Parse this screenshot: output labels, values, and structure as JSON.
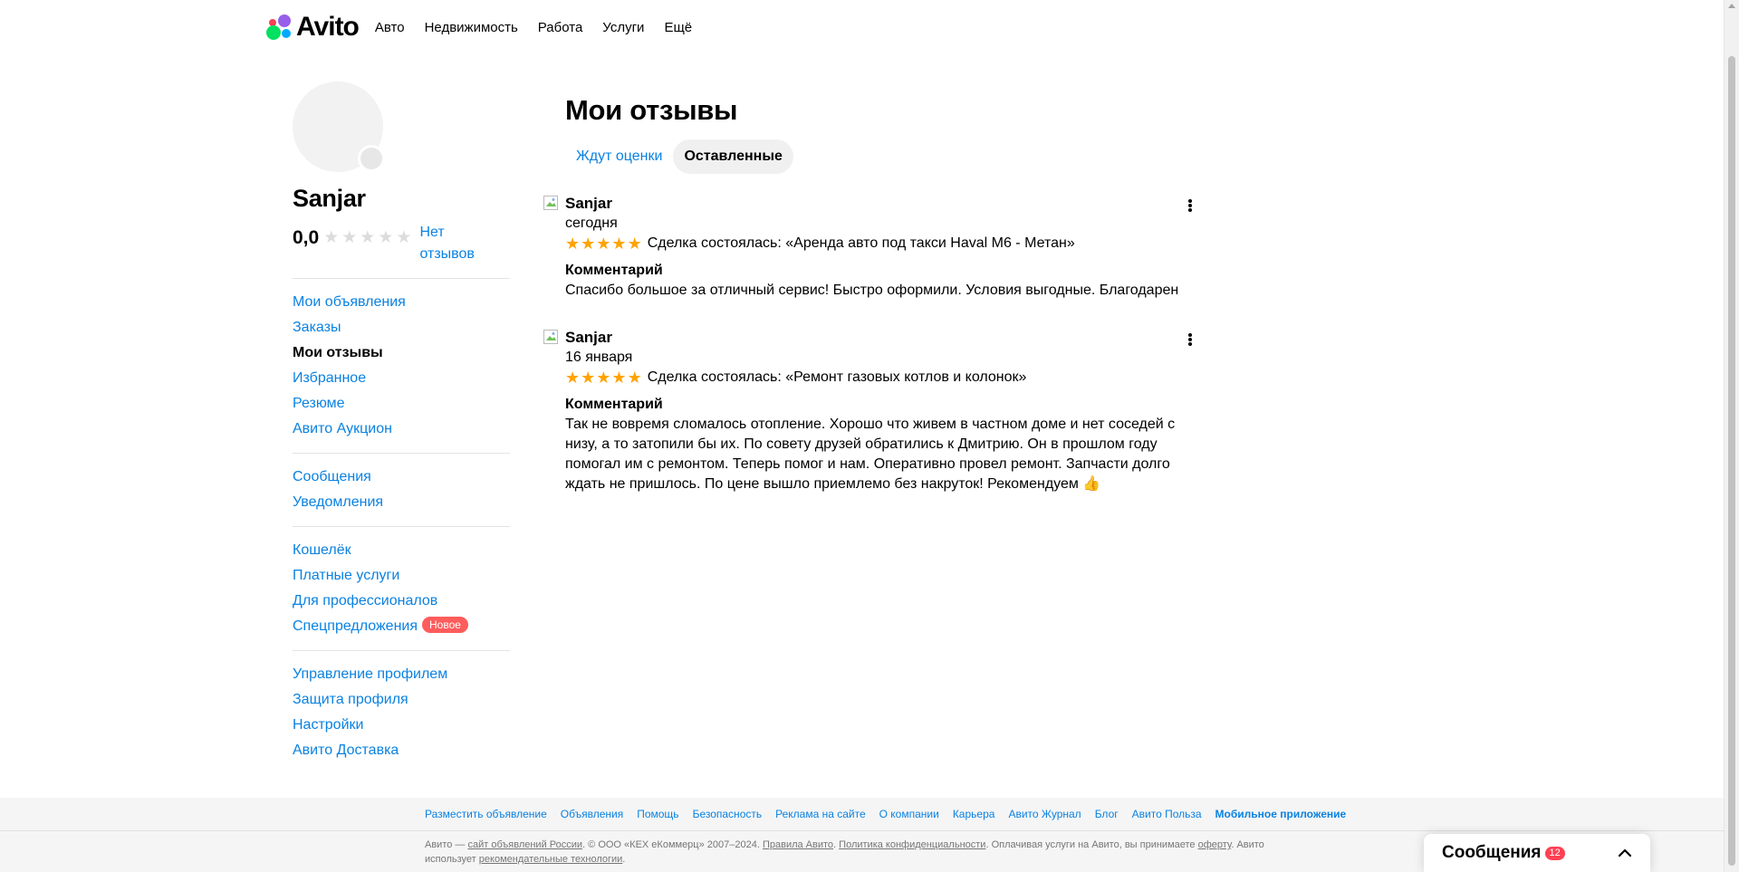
{
  "header": {
    "logo_text": "Avito",
    "nav": [
      "Авто",
      "Недвижимость",
      "Работа",
      "Услуги",
      "Ещё"
    ]
  },
  "profile": {
    "name": "Sanjar",
    "rating": "0,0",
    "rating_stars": 0,
    "no_reviews_line1": "Нет",
    "no_reviews_line2": "отзывов"
  },
  "sidebar": {
    "group1": [
      "Мои объявления",
      "Заказы",
      "Мои отзывы",
      "Избранное",
      "Резюме",
      "Авито Аукцион"
    ],
    "active_item": "Мои отзывы",
    "group2": [
      "Сообщения",
      "Уведомления"
    ],
    "group3": [
      "Кошелёк",
      "Платные услуги",
      "Для профессионалов",
      "Спецпредложения"
    ],
    "new_badge": "Новое",
    "group4": [
      "Управление профилем",
      "Защита профиля",
      "Настройки",
      "Авито Доставка"
    ]
  },
  "main": {
    "title": "Мои отзывы",
    "tabs": [
      {
        "label": "Ждут оценки",
        "active": false
      },
      {
        "label": "Оставленные",
        "active": true
      }
    ],
    "reviews": [
      {
        "author": "Sanjar",
        "date": "сегодня",
        "stars": 5,
        "deal": "Сделка состоялась: «Аренда авто под такси Haval M6 - Метан»",
        "comment_label": "Комментарий",
        "comment": "Спасибо большое за отличный сервис! Быстро оформили. Условия выгодные. Благодарен"
      },
      {
        "author": "Sanjar",
        "date": "16 января",
        "stars": 5,
        "deal": "Сделка состоялась: «Ремонт газовых котлов и колонок»",
        "comment_label": "Комментарий",
        "comment": "Так не вовремя сломалось отопление. Хорошо что живем в частном доме и нет соседей с низу, а то затопили бы их. По совету друзей обратились к Дмитрию. Он в прошлом году помогал им с ремонтом. Теперь помог и нам. Оперативно провел ремонт. Запчасти долго ждать не пришлось. По цене вышло приемлемо без накруток! Рекомендуем 👍"
      }
    ]
  },
  "footer": {
    "links": [
      "Разместить объявление",
      "Объявления",
      "Помощь",
      "Безопасность",
      "Реклама на сайте",
      "О компании",
      "Карьера",
      "Авито Журнал",
      "Блог",
      "Авито Польза",
      "Мобильное приложение"
    ],
    "legal": {
      "p1": "Авито — ",
      "l1": "сайт объявлений России",
      "p2": ". © ООО «КЕХ еКоммерц» 2007–2024. ",
      "l2": "Правила Авито",
      "p3": ". ",
      "l3": "Политика конфиденциальности",
      "p4": ". Оплачивая услуги на Авито, вы принимаете ",
      "l4": "оферту",
      "p5": ". Авито использует ",
      "l5": "рекомендательные технологии",
      "p6": "."
    }
  },
  "messages_widget": {
    "label": "Сообщения",
    "count": "12"
  },
  "colors": {
    "link": "#0a82e2",
    "star_active": "#ffa300",
    "star_inactive": "#dcdcdc",
    "badge_red": "#ff5c5c"
  }
}
